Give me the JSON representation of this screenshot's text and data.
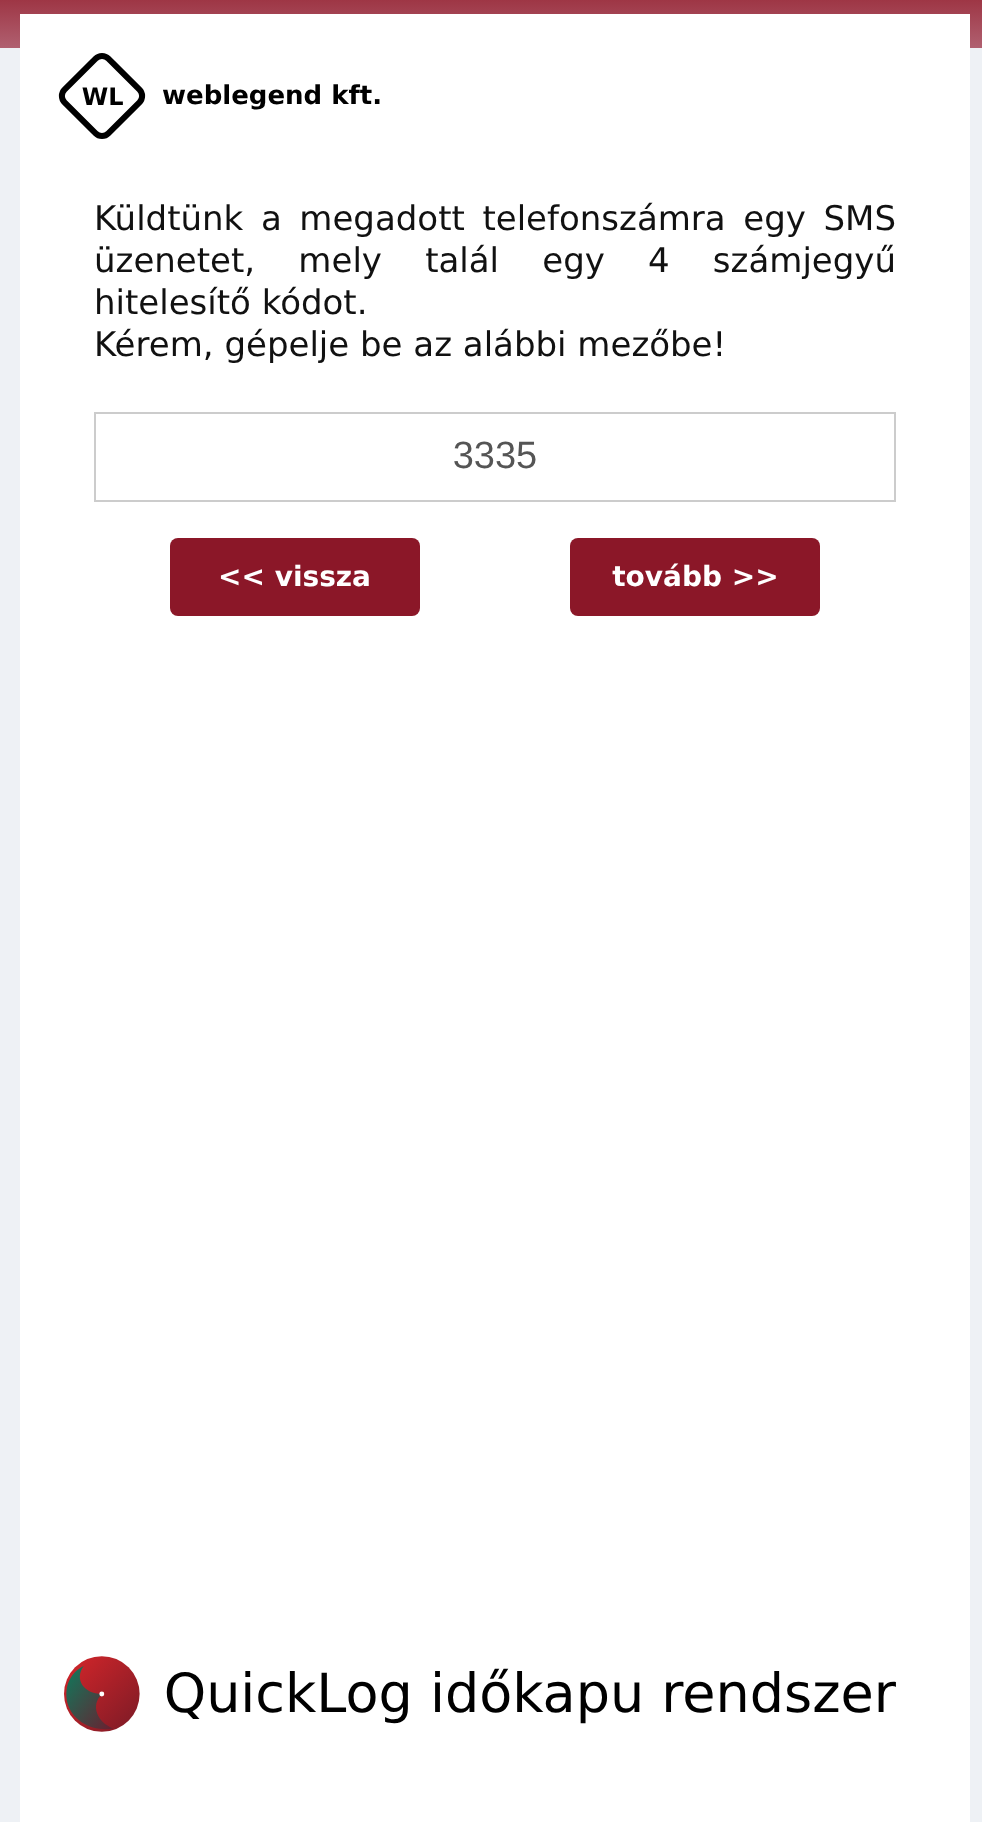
{
  "logo": {
    "mark": "WL",
    "name": "weblegend kft."
  },
  "message": [
    "Küldtünk a megadott telefonszámra egy SMS üzenetet, mely talál egy 4 számjegyű hitelesítő kódot.",
    "Kérem, gépelje be az alábbi mezőbe!"
  ],
  "code_field": {
    "value": "3335"
  },
  "buttons": [
    {
      "label": "<< vissza"
    },
    {
      "label": "tovább >>"
    }
  ],
  "footer": {
    "title": "QuickLog időkapu rendszer"
  }
}
